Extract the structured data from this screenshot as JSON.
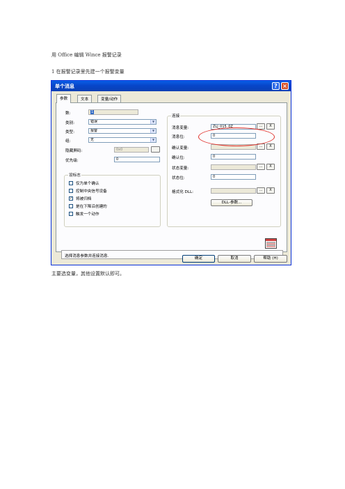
{
  "doc": {
    "heading": "用 Office 编辑 Wince 报警记录",
    "step1": "1  在报警记录里先建一个报警变量",
    "note": "主要选变量，其他设置默认即可。"
  },
  "dialog": {
    "title": "单个消息",
    "help_glyph": "?",
    "close_glyph": "×",
    "tabs": [
      "参数",
      "文本",
      "变量/动作"
    ],
    "left": {
      "number_label": "数:",
      "number_value": "1",
      "category_label": "类别:",
      "category_value": "错误",
      "type_label": "类型:",
      "type_value": "报警",
      "group_label": "组:",
      "group_value": "无",
      "hidden_mask_label": "隐藏屏码:",
      "hidden_mask_value": "0x0",
      "priority_label": "优先级:",
      "priority_value": "0"
    },
    "tags_group": {
      "title": "设标志",
      "items": [
        {
          "label": "仅为单个确认",
          "checked": false
        },
        {
          "label": "控制中央信号设备",
          "checked": false
        },
        {
          "label": "将被归档",
          "checked": true
        },
        {
          "label": "是在下降沿创建的",
          "checked": false
        },
        {
          "label": "触发一个动作",
          "checked": false
        }
      ]
    },
    "connect_group": {
      "title": "连接",
      "msg_var_label": "消息变量:",
      "msg_var_value": "ZLJ_015_0Z",
      "msg_bit_label": "消息位:",
      "msg_bit_value": "0",
      "ack_var_label": "确认变量:",
      "ack_bit_label": "确认位:",
      "ack_bit_value": "0",
      "status_var_label": "状态变量:",
      "status_bit_label": "状态位:",
      "status_bit_value": "0",
      "format_dll_label": "格式化 DLL:",
      "dll_params_button": "DLL-参数...",
      "browse_glyph": "...",
      "clear_glyph": "X"
    },
    "status_text": "选择消息参数并连接消息.",
    "buttons": {
      "ok": "确定",
      "cancel": "取消",
      "help": "帮助 (H)"
    }
  }
}
